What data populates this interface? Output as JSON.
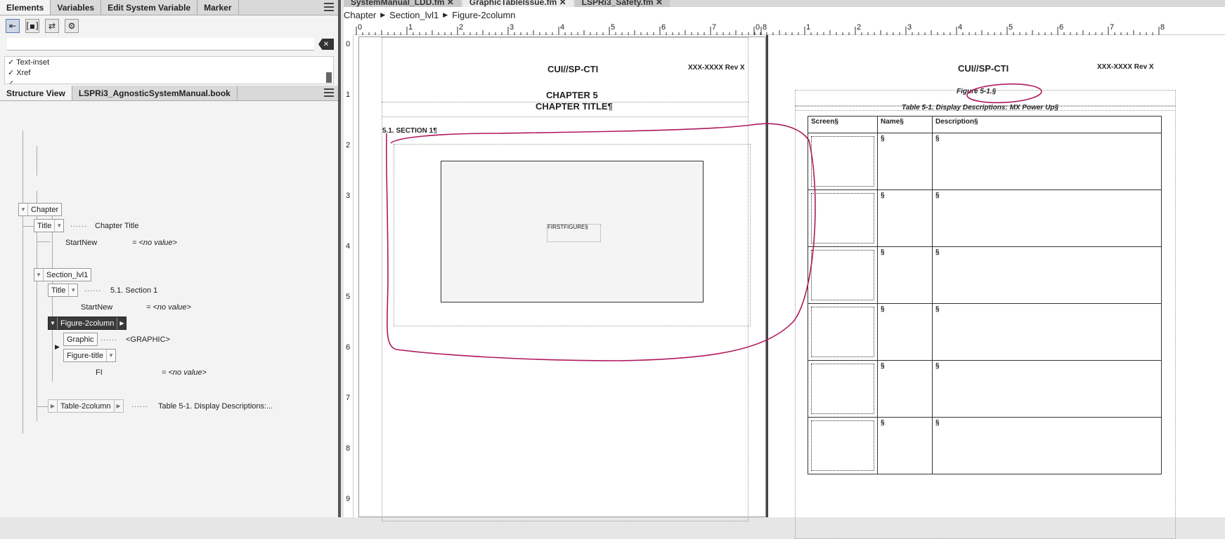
{
  "elements_panel": {
    "tabs": [
      "Elements",
      "Variables",
      "Edit System Variable",
      "Marker"
    ],
    "list": [
      "✓ Text-inset",
      "✓ Xref",
      "✓ ..."
    ]
  },
  "structure_panel": {
    "tabs": [
      "Structure View",
      "LSPRi3_AgnosticSystemManual.book"
    ],
    "tree": {
      "chapter": "Chapter",
      "title": "Title",
      "chapter_title_text": "Chapter Title",
      "startnew": "StartNew",
      "no_value": "= <no value>",
      "section": "Section_lvl1",
      "title2": "Title",
      "section_title_text": "5.1. Section 1",
      "startnew2": "StartNew",
      "figure": "Figure-2column",
      "graphic": "Graphic",
      "graphic_text": "<GRAPHIC>",
      "figure_title": "Figure-title",
      "fi": "FI",
      "table": "Table-2column",
      "table_text": "Table 5-1. Display Descriptions:..."
    }
  },
  "document": {
    "tabs": [
      "SystemManual_LDD.fm",
      "GraphicTableIssue.fm",
      "LSPRi3_Safety.fm"
    ],
    "breadcrumb": [
      "Chapter",
      "Section_lvl1",
      "Figure-2column"
    ],
    "left_page": {
      "classification": "CUI//SP-CTI",
      "doc_number": "XXX-XXXX Rev X",
      "chapter": "CHAPTER 5",
      "chapter_title": "CHAPTER TITLE¶",
      "section": "5.1.   SECTION 1¶",
      "figure_label": "FIRSTFIGURE§"
    },
    "right_page": {
      "classification": "CUI//SP-CTI",
      "doc_number": "XXX-XXXX Rev X",
      "figure_title": "Figure 5-1.§",
      "table_title": "Table 5-1. Display Descriptions: MX Power Up§",
      "columns": [
        "Screen§",
        "Name§",
        "Description§"
      ],
      "row_marks": [
        "§",
        "§"
      ],
      "row_count": 6
    },
    "ruler_left": [
      "0",
      "1",
      "2",
      "3",
      "4",
      "5",
      "6",
      "7",
      "8"
    ],
    "ruler_right": [
      "0",
      "1",
      "2",
      "3",
      "4",
      "5",
      "6",
      "7",
      "8"
    ],
    "vruler": [
      "0",
      "1",
      "2",
      "3",
      "4",
      "5",
      "6",
      "7",
      "8",
      "9"
    ],
    "annotation_color": "#b0185c"
  }
}
